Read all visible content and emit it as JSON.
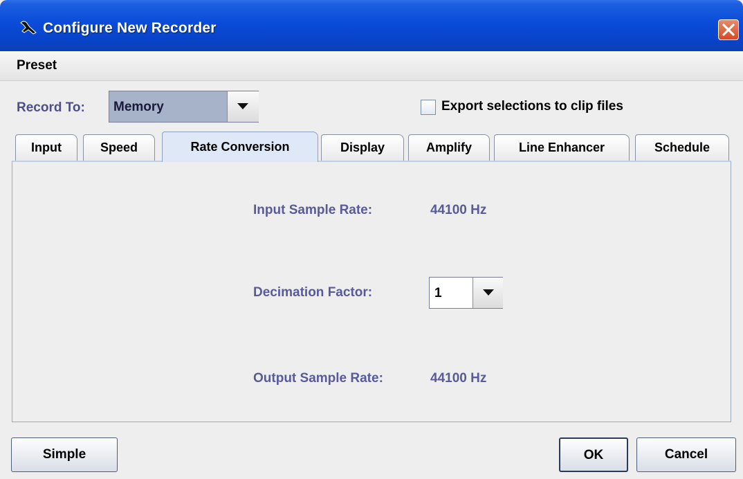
{
  "window": {
    "title": "Configure New Recorder",
    "title_bar_color": "#0a4bd8",
    "close_color": "#d54a24"
  },
  "menubar": {
    "preset": "Preset"
  },
  "record": {
    "label": "Record To:",
    "value": "Memory",
    "export_label": "Export selections to clip files",
    "export_checked": false
  },
  "tabs": [
    {
      "label": "Input"
    },
    {
      "label": "Speed"
    },
    {
      "label": "Rate Conversion",
      "active": true
    },
    {
      "label": "Display"
    },
    {
      "label": "Amplify"
    },
    {
      "label": "Line Enhancer"
    },
    {
      "label": "Schedule"
    }
  ],
  "rate_conversion": {
    "input_label": "Input Sample Rate:",
    "input_value": "44100 Hz",
    "decimation_label": "Decimation Factor:",
    "decimation_value": "1",
    "output_label": "Output Sample Rate:",
    "output_value": "44100 Hz",
    "label_color": "#5a5a9a"
  },
  "buttons": {
    "simple": "Simple",
    "ok": "OK",
    "cancel": "Cancel"
  }
}
